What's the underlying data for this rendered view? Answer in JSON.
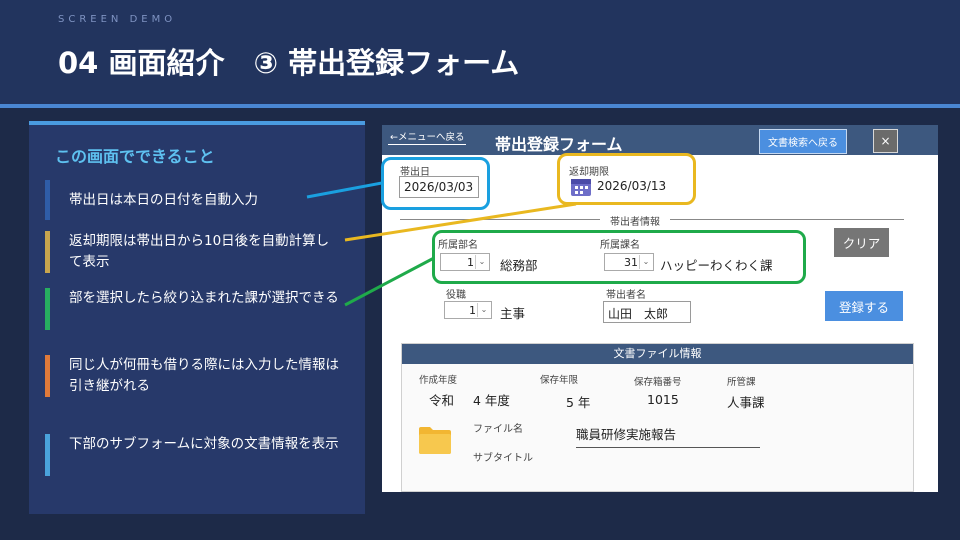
{
  "header": {
    "eyebrow": "SCREEN DEMO",
    "title": "04 画面紹介　③ 帯出登録フォーム"
  },
  "panel": {
    "heading": "この画面でできること",
    "items": [
      {
        "text": "帯出日は本日の日付を自動入力",
        "color": "#2f5da8"
      },
      {
        "text": "返却期限は帯出日から10日後を自動計算して表示",
        "color": "#c8a54e"
      },
      {
        "text": "部を選択したら絞り込まれた課が選択できる",
        "color": "#27ae60"
      },
      {
        "text": "同じ人が何冊も借りる際には入力した情報は引き継がれる",
        "color": "#e07a3a"
      },
      {
        "text": "下部のサブフォームに対象の文書情報を表示",
        "color": "#4aa3dc"
      }
    ]
  },
  "form": {
    "back_label": "←メニューへ戻る",
    "title": "帯出登録フォーム",
    "search_button": "文書検索へ戻る",
    "close_button": "×",
    "checkout_date_label": "帯出日",
    "checkout_date": "2026/03/03",
    "return_date_label": "返却期限",
    "return_date": "2026/03/13",
    "section_label": "帯出者情報",
    "dept_label": "所属部名",
    "dept_code": "1",
    "dept_name": "総務部",
    "section_name_label": "所属課名",
    "section_code": "31",
    "section_name": "ハッピーわくわく課",
    "clear_button": "クリア",
    "position_label": "役職",
    "position_code": "1",
    "position_name": "主事",
    "borrower_label": "帯出者名",
    "borrower_name": "山田　太郎",
    "register_button": "登録する"
  },
  "doc": {
    "header": "文書ファイル情報",
    "year_label": "作成年度",
    "era": "令和",
    "year": "4 年度",
    "retention_label": "保存年限",
    "retention": "5 年",
    "box_label": "保存箱番号",
    "box": "1015",
    "dept_label": "所管課",
    "dept": "人事課",
    "file_label": "ファイル名",
    "file_name": "職員研修実施報告",
    "subtitle_label": "サブタイトル"
  },
  "colors": {
    "blue": "#1aa0e0",
    "yellow": "#e9b820",
    "green": "#1faa4a"
  }
}
